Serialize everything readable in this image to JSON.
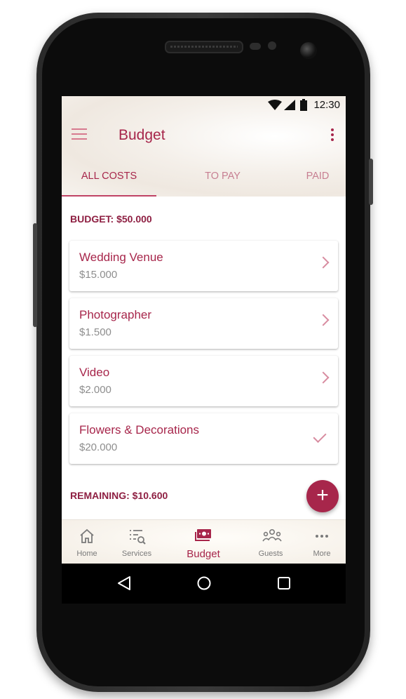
{
  "status_bar": {
    "time": "12:30"
  },
  "app_bar": {
    "title": "Budget",
    "menu_icon": "hamburger-menu-icon",
    "overflow_icon": "more-vert-icon"
  },
  "tabs": [
    {
      "label": "ALL COSTS",
      "active": true
    },
    {
      "label": "TO PAY",
      "active": false
    },
    {
      "label": "PAID",
      "active": false
    }
  ],
  "budget_label": "BUDGET: $50.000",
  "items": [
    {
      "name": "Wedding Venue",
      "amount": "$15.000",
      "status": "chevron-right-icon"
    },
    {
      "name": "Photographer",
      "amount": "$1.500",
      "status": "chevron-right-icon"
    },
    {
      "name": "Video",
      "amount": "$2.000",
      "status": "chevron-right-icon"
    },
    {
      "name": "Flowers & Decorations",
      "amount": "$20.000",
      "status": "check-icon"
    }
  ],
  "remaining_label": "REMAINING: $10.600",
  "fab": {
    "label": "+",
    "icon": "add-icon"
  },
  "bottom_nav": [
    {
      "label": "Home",
      "icon": "home-icon",
      "active": false
    },
    {
      "label": "Services",
      "icon": "services-search-icon",
      "active": false
    },
    {
      "label": "Budget",
      "icon": "budget-money-icon",
      "active": true
    },
    {
      "label": "Guests",
      "icon": "guests-group-icon",
      "active": false
    },
    {
      "label": "More",
      "icon": "more-horiz-icon",
      "active": false
    }
  ],
  "colors": {
    "primary": "#a7264b",
    "accent": "#c04365",
    "muted": "#c77f92"
  }
}
